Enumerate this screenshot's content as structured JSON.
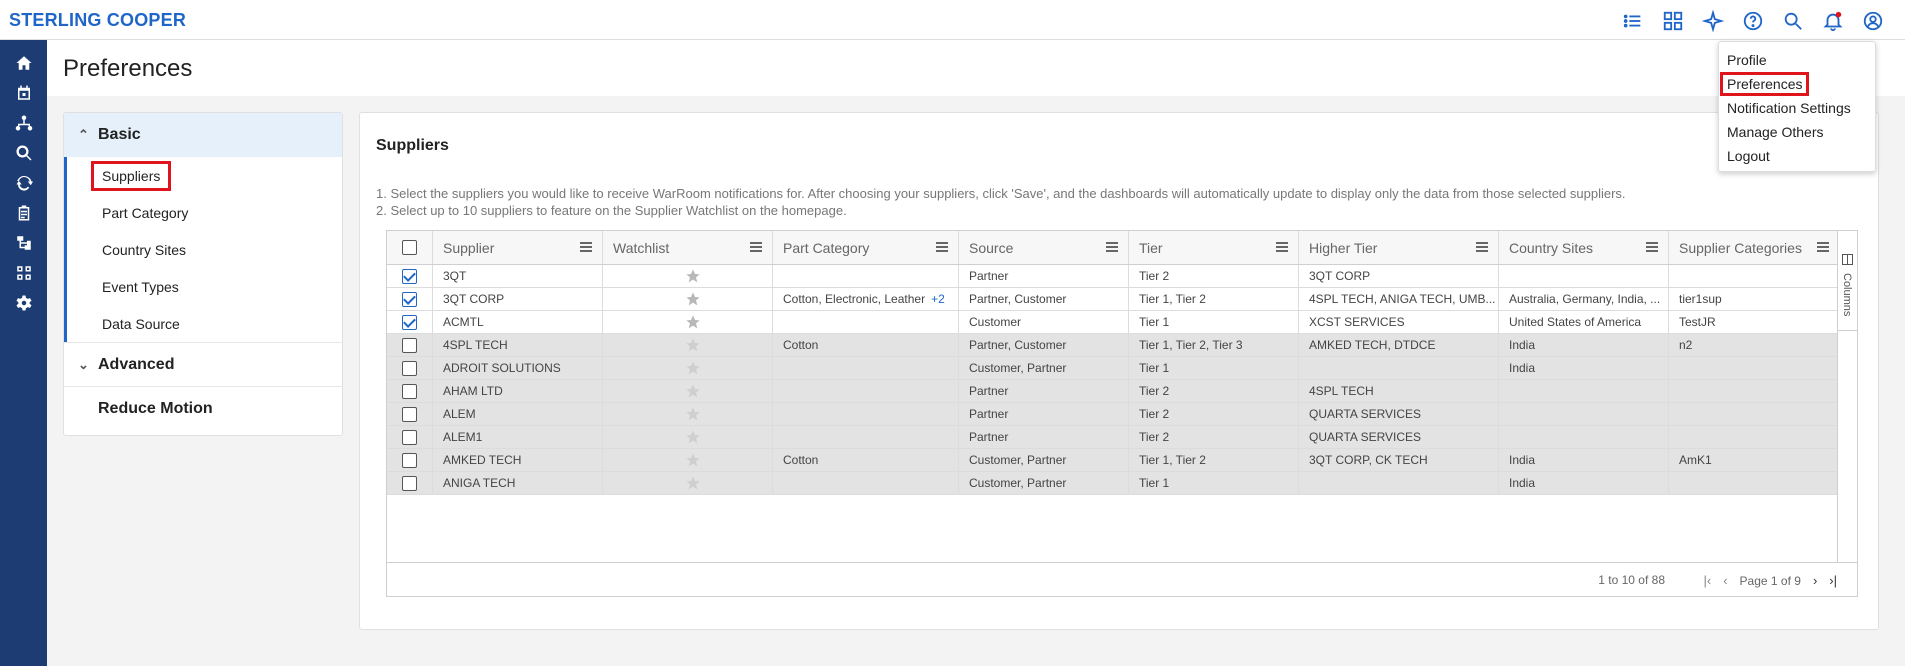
{
  "app": {
    "brand": "STERLING COOPER",
    "page_title": "Preferences"
  },
  "header_icons": [
    "list-icon",
    "dashboard-icon",
    "sparkle-icon",
    "help-icon",
    "search-icon",
    "bell-icon",
    "user-icon"
  ],
  "left_nav_icons": [
    "home-icon",
    "calendar-icon",
    "network-icon",
    "search-icon",
    "refresh-icon",
    "clipboard-icon",
    "hierarchy-icon",
    "grid-icon",
    "settings-icon"
  ],
  "settings_menu": {
    "basic_label": "Basic",
    "basic_items": [
      "Suppliers",
      "Part Category",
      "Country Sites",
      "Event Types",
      "Data Source"
    ],
    "advanced_label": "Advanced",
    "reduce_motion_label": "Reduce Motion"
  },
  "section": {
    "title": "Suppliers",
    "instruction_1": "1. Select the suppliers you would like to receive WarRoom notifications for. After choosing your suppliers, click 'Save', and the dashboards will automatically update to display only the data from those selected suppliers.",
    "instruction_2": "2. Select up to 10 suppliers to feature on the Supplier Watchlist on the homepage."
  },
  "table": {
    "columns": [
      "Supplier",
      "Watchlist",
      "Part Category",
      "Source",
      "Tier",
      "Higher Tier",
      "Country Sites",
      "Supplier Categories"
    ],
    "rows": [
      {
        "checked": true,
        "supplier": "3QT",
        "part_category": "",
        "more": "",
        "source": "Partner",
        "tier": "Tier 2",
        "higher_tier": "3QT CORP",
        "country_sites": "",
        "supplier_categories": ""
      },
      {
        "checked": true,
        "supplier": "3QT CORP",
        "part_category": "Cotton, Electronic, Leather",
        "more": "+2",
        "source": "Partner, Customer",
        "tier": "Tier 1, Tier 2",
        "higher_tier": "4SPL TECH, ANIGA TECH, UMB...",
        "country_sites": "Australia, Germany, India, ...",
        "supplier_categories": "tier1sup"
      },
      {
        "checked": true,
        "supplier": "ACMTL",
        "part_category": "",
        "more": "",
        "source": "Customer",
        "tier": "Tier 1",
        "higher_tier": "XCST SERVICES",
        "country_sites": "United States of America",
        "supplier_categories": "TestJR"
      },
      {
        "checked": false,
        "supplier": "4SPL TECH",
        "part_category": "Cotton",
        "more": "",
        "source": "Partner, Customer",
        "tier": "Tier 1, Tier 2, Tier 3",
        "higher_tier": "AMKED TECH, DTDCE",
        "country_sites": "India",
        "supplier_categories": "n2"
      },
      {
        "checked": false,
        "supplier": "ADROIT SOLUTIONS",
        "part_category": "",
        "more": "",
        "source": "Customer, Partner",
        "tier": "Tier 1",
        "higher_tier": "",
        "country_sites": "India",
        "supplier_categories": ""
      },
      {
        "checked": false,
        "supplier": "AHAM LTD",
        "part_category": "",
        "more": "",
        "source": "Partner",
        "tier": "Tier 2",
        "higher_tier": "4SPL TECH",
        "country_sites": "",
        "supplier_categories": ""
      },
      {
        "checked": false,
        "supplier": "ALEM",
        "part_category": "",
        "more": "",
        "source": "Partner",
        "tier": "Tier 2",
        "higher_tier": "QUARTA SERVICES",
        "country_sites": "",
        "supplier_categories": ""
      },
      {
        "checked": false,
        "supplier": "ALEM1",
        "part_category": "",
        "more": "",
        "source": "Partner",
        "tier": "Tier 2",
        "higher_tier": "QUARTA SERVICES",
        "country_sites": "",
        "supplier_categories": ""
      },
      {
        "checked": false,
        "supplier": "AMKED TECH",
        "part_category": "Cotton",
        "more": "",
        "source": "Customer, Partner",
        "tier": "Tier 1, Tier 2",
        "higher_tier": "3QT CORP, CK TECH",
        "country_sites": "India",
        "supplier_categories": "AmK1"
      },
      {
        "checked": false,
        "supplier": "ANIGA TECH",
        "part_category": "",
        "more": "",
        "source": "Customer, Partner",
        "tier": "Tier 1",
        "higher_tier": "",
        "country_sites": "India",
        "supplier_categories": ""
      }
    ],
    "columns_panel_label": "Columns",
    "footer": {
      "count": "1 to 10 of 88",
      "page": "Page 1 of 9"
    }
  },
  "profile_menu": {
    "items": [
      "Profile",
      "Preferences",
      "Notification Settings",
      "Manage Others",
      "Logout"
    ]
  },
  "colors": {
    "brand": "#1f66c8",
    "nav_bg": "#1e3c74",
    "highlight": "#e0141c"
  }
}
